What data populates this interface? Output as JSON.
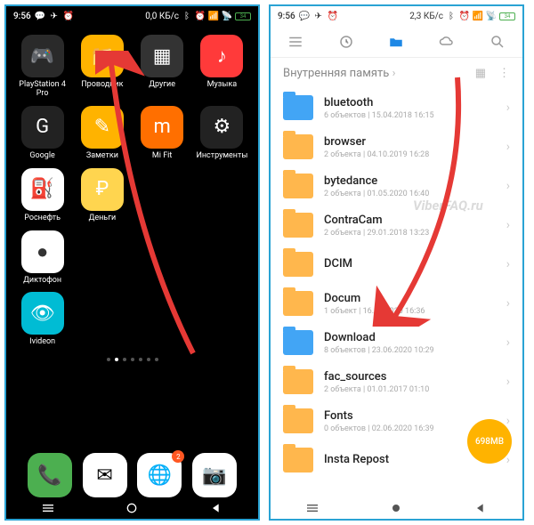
{
  "left_phone": {
    "status": {
      "time": "9:56",
      "speed": "0,0 КБ/с"
    },
    "apps": [
      {
        "label": "PlayStation 4 Pro",
        "bg": "#2a2a2a",
        "icon": "🎮"
      },
      {
        "label": "Проводник",
        "bg": "#ffb300",
        "icon": "📁"
      },
      {
        "label": "Другие",
        "bg": "#333",
        "icon": "▦"
      },
      {
        "label": "Музыка",
        "bg": "#ff3a3a",
        "icon": "♪"
      },
      {
        "label": "Google",
        "bg": "#222",
        "icon": "G"
      },
      {
        "label": "Заметки",
        "bg": "#ffb300",
        "icon": "✎"
      },
      {
        "label": "Mi Fit",
        "bg": "#ff6f00",
        "icon": "m"
      },
      {
        "label": "Инструменты",
        "bg": "#222",
        "icon": "⚙"
      },
      {
        "label": "Роснефть",
        "bg": "#fff",
        "icon": "⛽"
      },
      {
        "label": "Деньги",
        "bg": "#ffd54f",
        "icon": "₽"
      },
      {
        "label": "",
        "bg": "transparent",
        "icon": ""
      },
      {
        "label": "",
        "bg": "transparent",
        "icon": ""
      },
      {
        "label": "Диктофон",
        "bg": "#fff",
        "icon": "●"
      },
      {
        "label": "",
        "bg": "transparent",
        "icon": ""
      },
      {
        "label": "",
        "bg": "transparent",
        "icon": ""
      },
      {
        "label": "",
        "bg": "transparent",
        "icon": ""
      },
      {
        "label": "Ivideon",
        "bg": "#00bcd4",
        "icon": "👁"
      }
    ],
    "dock": [
      {
        "bg": "#4caf50",
        "icon": "📞"
      },
      {
        "bg": "#fff",
        "icon": "✉"
      },
      {
        "bg": "#fff",
        "icon": "🌐",
        "badge": "2"
      },
      {
        "bg": "#fff",
        "icon": "📷"
      }
    ]
  },
  "right_phone": {
    "status": {
      "time": "9:56",
      "speed": "2,3 КБ/с"
    },
    "breadcrumb": "Внутренняя память",
    "folders": [
      {
        "name": "bluetooth",
        "meta": "6 объектов | 15.04.2018 16:15",
        "color": "blue"
      },
      {
        "name": "browser",
        "meta": "2 объекта | 04.10.2019 16:28",
        "color": "orange"
      },
      {
        "name": "bytedance",
        "meta": "2 объекта | 01.05.2020 16:40",
        "color": "orange"
      },
      {
        "name": "ContraCam",
        "meta": "2 объекта | 29.01.2018 13:23",
        "color": "orange"
      },
      {
        "name": "DCIM",
        "meta": "",
        "color": "orange"
      },
      {
        "name": "Docum",
        "meta": "1 объект | 16.05.2020 16:36",
        "color": "orange"
      },
      {
        "name": "Download",
        "meta": "8 объектов | 23.06.2020 10:29",
        "color": "blue"
      },
      {
        "name": "fac_sources",
        "meta": "2 объекта | 01.01.2017 01:10",
        "color": "orange"
      },
      {
        "name": "Fonts",
        "meta": "0 объектов | 02.06.2020 16:39",
        "color": "orange"
      },
      {
        "name": "Insta Repost",
        "meta": "",
        "color": "orange"
      }
    ],
    "size_badge": "698MB",
    "watermark": "ViberFAQ.ru"
  }
}
